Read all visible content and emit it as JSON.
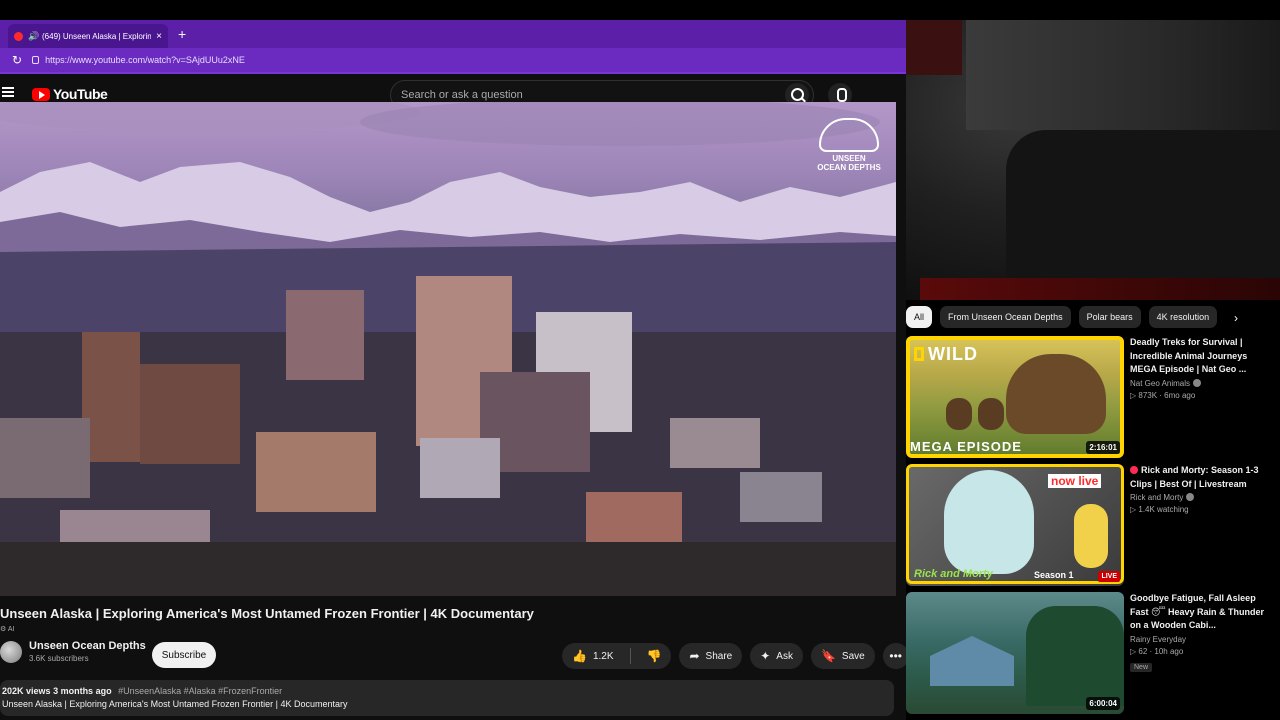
{
  "browser": {
    "tab_title": "(649) Unseen Alaska | Explorin",
    "new_tab": "+",
    "close": "×",
    "url": "https://www.youtube.com/watch?v=SAjdUUu2xNE"
  },
  "header": {
    "logo_text": "YouTube",
    "search_placeholder": "Search or ask a question"
  },
  "video": {
    "watermark_line1": "UNSEEN",
    "watermark_line2": "OCEAN DEPTHS",
    "title": "Unseen Alaska | Exploring America's Most Untamed Frozen Frontier | 4K Documentary",
    "ai_label": "AI",
    "channel_name": "Unseen Ocean Depths",
    "subscribers": "3.6K subscribers",
    "subscribe_label": "Subscribe",
    "likes": "1.2K",
    "share_label": "Share",
    "ask_label": "Ask",
    "save_label": "Save",
    "more_label": "•••",
    "views": "202K views",
    "age": "3 months ago",
    "hashtags": "#UnseenAlaska #Alaska #FrozenFrontier",
    "description": "Unseen Alaska | Exploring America's Most Untamed Frozen Frontier | 4K Documentary"
  },
  "chips": [
    "All",
    "From Unseen Ocean Depths",
    "Polar bears",
    "4K resolution"
  ],
  "recommendations": [
    {
      "title": "Deadly Treks for Survival | Incredible Animal Journeys MEGA Episode | Nat Geo ...",
      "channel": "Nat Geo Animals",
      "stats": "▷ 873K · 6mo ago",
      "duration": "2:16:01",
      "thumb_top": "WILD",
      "thumb_bottom": "MEGA EPISODE"
    },
    {
      "title": "Rick and Morty: Season 1-3 Clips | Best Of | Livestream",
      "channel": "Rick and Morty",
      "stats": "▷ 1.4K watching",
      "badge": "LIVE",
      "thumb_top": "now live",
      "thumb_bottom": "Season 1",
      "thumb_logo": "Rick and Morty"
    },
    {
      "title": "Goodbye Fatigue, Fall Asleep Fast 😴 Heavy Rain & Thunder on a Wooden Cabi...",
      "channel": "Rainy Everyday",
      "stats": "▷ 62 · 10h ago",
      "new_label": "New",
      "duration": "6:00:04"
    }
  ],
  "colors": {
    "tab_bar": "#5b1fa8",
    "address_bar": "#6b2bc0",
    "youtube_red": "#ff0000",
    "page_bg": "#0f0f0f"
  }
}
